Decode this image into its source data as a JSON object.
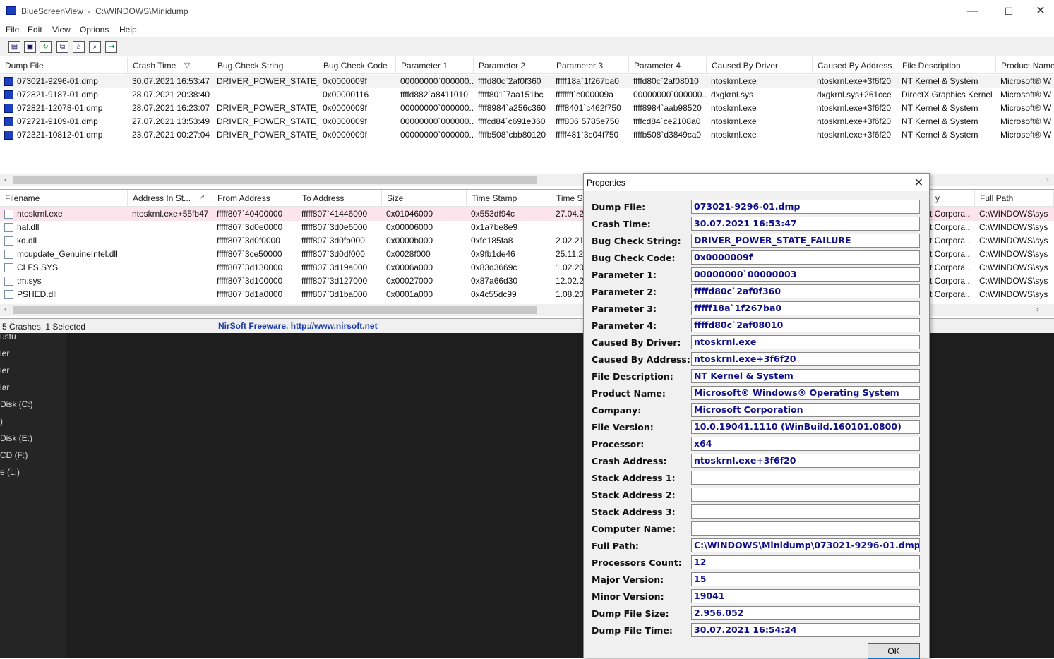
{
  "window": {
    "title": "BlueScreenView  -  C:\\WINDOWS\\Minidump",
    "minimize": "—",
    "maximize": "☐",
    "close": "✕"
  },
  "menu": [
    "File",
    "Edit",
    "View",
    "Options",
    "Help"
  ],
  "toolbar_icons": [
    "properties-icon",
    "save-icon",
    "refresh-icon",
    "copy-icon",
    "html-report-icon",
    "find-icon",
    "exit-icon"
  ],
  "crash_list": {
    "columns": [
      "Dump File",
      "Crash Time",
      "Bug Check String",
      "Bug Check Code",
      "Parameter 1",
      "Parameter 2",
      "Parameter 3",
      "Parameter 4",
      "Caused By Driver",
      "Caused By Address",
      "File Description",
      "Product Name"
    ],
    "sort_indicator": "▽",
    "rows": [
      [
        "073021-9296-01.dmp",
        "30.07.2021 16:53:47",
        "DRIVER_POWER_STATE_F...",
        "0x0000009f",
        "00000000`000000...",
        "ffffd80c`2af0f360",
        "fffff18a`1f267ba0",
        "ffffd80c`2af08010",
        "ntoskrnl.exe",
        "ntoskrnl.exe+3f6f20",
        "NT Kernel & System",
        "Microsoft® W"
      ],
      [
        "072821-9187-01.dmp",
        "28.07.2021 20:38:40",
        "",
        "0x00000116",
        "ffffd882`a8411010",
        "fffff801`7aa151bc",
        "ffffffff`c000009a",
        "00000000`000000...",
        "dxgkrnl.sys",
        "dxgkrnl.sys+261cce",
        "DirectX Graphics Kernel",
        "Microsoft® W"
      ],
      [
        "072821-12078-01.dmp",
        "28.07.2021 16:23:07",
        "DRIVER_POWER_STATE_F...",
        "0x0000009f",
        "00000000`000000...",
        "ffff8984`a256c360",
        "ffff8401`c462f750",
        "ffff8984`aab98520",
        "ntoskrnl.exe",
        "ntoskrnl.exe+3f6f20",
        "NT Kernel & System",
        "Microsoft® W"
      ],
      [
        "072721-9109-01.dmp",
        "27.07.2021 13:53:49",
        "DRIVER_POWER_STATE_F...",
        "0x0000009f",
        "00000000`000000...",
        "ffffcd84`c691e360",
        "ffff806`5785e750",
        "ffffcd84`ce2108a0",
        "ntoskrnl.exe",
        "ntoskrnl.exe+3f6f20",
        "NT Kernel & System",
        "Microsoft® W"
      ],
      [
        "072321-10812-01.dmp",
        "23.07.2021 00:27:04",
        "DRIVER_POWER_STATE_F...",
        "0x0000009f",
        "00000000`000000...",
        "ffffb508`cbb80120",
        "fffff481`3c04f750",
        "ffffb508`d3849ca0",
        "ntoskrnl.exe",
        "ntoskrnl.exe+3f6f20",
        "NT Kernel & System",
        "Microsoft® W"
      ]
    ]
  },
  "driver_list": {
    "columns": [
      "Filename",
      "Address In St...",
      "From Address",
      "To Address",
      "Size",
      "Time Stamp",
      "Time St",
      "Full Path"
    ],
    "sort_indicator": "↗",
    "rows": [
      [
        "ntoskrnl.exe",
        "ntoskrnl.exe+55fb47",
        "fffff807`40400000",
        "fffff807`41446000",
        "0x01046000",
        "0x553df94c",
        "27.04.20",
        "C:\\WINDOWS\\sys"
      ],
      [
        "hal.dll",
        "",
        "fffff807`3d0e0000",
        "fffff807`3d0e6000",
        "0x00006000",
        "0x1a7be8e9",
        "",
        "C:\\WINDOWS\\sys"
      ],
      [
        "kd.dll",
        "",
        "fffff807`3d0f0000",
        "fffff807`3d0fb000",
        "0x0000b000",
        "0xfe185fa8",
        "2.02.21",
        "C:\\WINDOWS\\sys"
      ],
      [
        "mcupdate_GenuineIntel.dll",
        "",
        "fffff807`3ce50000",
        "fffff807`3d0df000",
        "0x0028f000",
        "0x9fb1de46",
        "25.11.20",
        "C:\\WINDOWS\\sys"
      ],
      [
        "CLFS.SYS",
        "",
        "fffff807`3d130000",
        "fffff807`3d19a000",
        "0x0006a000",
        "0x83d3669c",
        "1.02.20",
        "C:\\WINDOWS\\sys"
      ],
      [
        "tm.sys",
        "",
        "fffff807`3d100000",
        "fffff807`3d127000",
        "0x00027000",
        "0x87a66d30",
        "12.02.20",
        "C:\\WINDOWS\\sys"
      ],
      [
        "PSHED.dll",
        "",
        "fffff807`3d1a0000",
        "fffff807`3d1ba000",
        "0x0001a000",
        "0x4c55dc99",
        "1.08.20",
        "C:\\WINDOWS\\sys"
      ]
    ],
    "partial_company": "t Corpora...",
    "partial_col": "y"
  },
  "status": {
    "text": "5 Crashes, 1 Selected",
    "link": "NirSoft Freeware.  http://www.nirsoft.net"
  },
  "sidebar_partial": [
    "ustu",
    "ler",
    "ler",
    "lar",
    "Disk (C:)",
    ")",
    "Disk (E:)",
    "CD (F:)",
    "e (L:)"
  ],
  "dialog": {
    "title": "Properties",
    "close": "✕",
    "ok": "OK",
    "fields": [
      {
        "label": "Dump File:",
        "value": "073021-9296-01.dmp"
      },
      {
        "label": "Crash Time:",
        "value": "30.07.2021 16:53:47"
      },
      {
        "label": "Bug Check String:",
        "value": "DRIVER_POWER_STATE_FAILURE"
      },
      {
        "label": "Bug Check Code:",
        "value": "0x0000009f"
      },
      {
        "label": "Parameter 1:",
        "value": "00000000`00000003"
      },
      {
        "label": "Parameter 2:",
        "value": "ffffd80c`2af0f360"
      },
      {
        "label": "Parameter 3:",
        "value": "fffff18a`1f267ba0"
      },
      {
        "label": "Parameter 4:",
        "value": "ffffd80c`2af08010"
      },
      {
        "label": "Caused By Driver:",
        "value": "ntoskrnl.exe"
      },
      {
        "label": "Caused By Address:",
        "value": "ntoskrnl.exe+3f6f20"
      },
      {
        "label": "File Description:",
        "value": "NT Kernel & System"
      },
      {
        "label": "Product Name:",
        "value": "Microsoft® Windows® Operating System"
      },
      {
        "label": "Company:",
        "value": "Microsoft Corporation"
      },
      {
        "label": "File Version:",
        "value": "10.0.19041.1110 (WinBuild.160101.0800)"
      },
      {
        "label": "Processor:",
        "value": "x64"
      },
      {
        "label": "Crash Address:",
        "value": "ntoskrnl.exe+3f6f20"
      },
      {
        "label": "Stack Address 1:",
        "value": ""
      },
      {
        "label": "Stack Address 2:",
        "value": ""
      },
      {
        "label": "Stack Address 3:",
        "value": ""
      },
      {
        "label": "Computer Name:",
        "value": ""
      },
      {
        "label": "Full Path:",
        "value": "C:\\WINDOWS\\Minidump\\073021-9296-01.dmp"
      },
      {
        "label": "Processors Count:",
        "value": "12"
      },
      {
        "label": "Major Version:",
        "value": "15"
      },
      {
        "label": "Minor Version:",
        "value": "19041"
      },
      {
        "label": "Dump File Size:",
        "value": "2.956.052"
      },
      {
        "label": "Dump File Time:",
        "value": "30.07.2021 16:54:24"
      }
    ]
  }
}
